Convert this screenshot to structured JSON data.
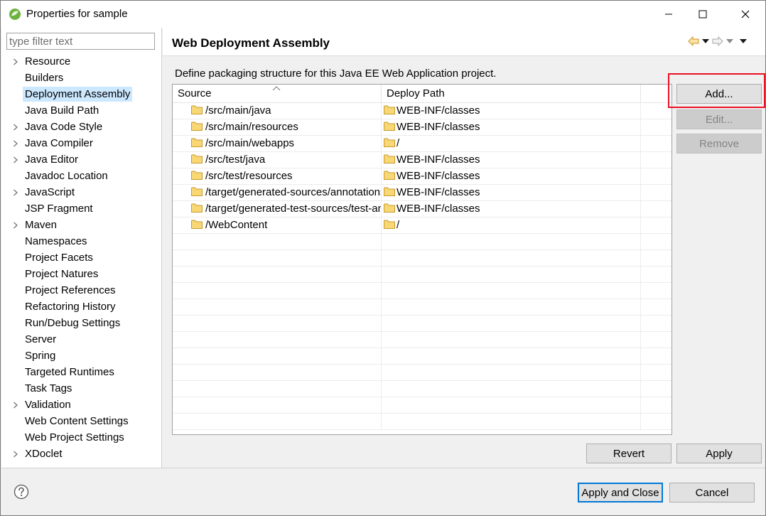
{
  "window": {
    "title": "Properties for sample"
  },
  "filter": {
    "placeholder": "type filter text"
  },
  "tree": {
    "items": [
      {
        "label": "Resource",
        "expandable": true,
        "selected": false
      },
      {
        "label": "Builders",
        "expandable": false,
        "selected": false
      },
      {
        "label": "Deployment Assembly",
        "expandable": false,
        "selected": true
      },
      {
        "label": "Java Build Path",
        "expandable": false,
        "selected": false
      },
      {
        "label": "Java Code Style",
        "expandable": true,
        "selected": false
      },
      {
        "label": "Java Compiler",
        "expandable": true,
        "selected": false
      },
      {
        "label": "Java Editor",
        "expandable": true,
        "selected": false
      },
      {
        "label": "Javadoc Location",
        "expandable": false,
        "selected": false
      },
      {
        "label": "JavaScript",
        "expandable": true,
        "selected": false
      },
      {
        "label": "JSP Fragment",
        "expandable": false,
        "selected": false
      },
      {
        "label": "Maven",
        "expandable": true,
        "selected": false
      },
      {
        "label": "Namespaces",
        "expandable": false,
        "selected": false
      },
      {
        "label": "Project Facets",
        "expandable": false,
        "selected": false
      },
      {
        "label": "Project Natures",
        "expandable": false,
        "selected": false
      },
      {
        "label": "Project References",
        "expandable": false,
        "selected": false
      },
      {
        "label": "Refactoring History",
        "expandable": false,
        "selected": false
      },
      {
        "label": "Run/Debug Settings",
        "expandable": false,
        "selected": false
      },
      {
        "label": "Server",
        "expandable": false,
        "selected": false
      },
      {
        "label": "Spring",
        "expandable": false,
        "selected": false
      },
      {
        "label": "Targeted Runtimes",
        "expandable": false,
        "selected": false
      },
      {
        "label": "Task Tags",
        "expandable": false,
        "selected": false
      },
      {
        "label": "Validation",
        "expandable": true,
        "selected": false
      },
      {
        "label": "Web Content Settings",
        "expandable": false,
        "selected": false
      },
      {
        "label": "Web Project Settings",
        "expandable": false,
        "selected": false
      },
      {
        "label": "XDoclet",
        "expandable": true,
        "selected": false
      }
    ]
  },
  "page": {
    "title": "Web Deployment Assembly",
    "description": "Define packaging structure for this Java EE Web Application project."
  },
  "table": {
    "columns": {
      "source": "Source",
      "deploy_path": "Deploy Path"
    },
    "rows": [
      {
        "source": "/src/main/java",
        "deploy_path": "WEB-INF/classes"
      },
      {
        "source": "/src/main/resources",
        "deploy_path": "WEB-INF/classes"
      },
      {
        "source": "/src/main/webapps",
        "deploy_path": "/"
      },
      {
        "source": "/src/test/java",
        "deploy_path": "WEB-INF/classes"
      },
      {
        "source": "/src/test/resources",
        "deploy_path": "WEB-INF/classes"
      },
      {
        "source": "/target/generated-sources/annotations",
        "deploy_path": "WEB-INF/classes"
      },
      {
        "source": "/target/generated-test-sources/test-annotations",
        "deploy_path": "WEB-INF/classes"
      },
      {
        "source": "/WebContent",
        "deploy_path": "/"
      }
    ],
    "empty_rows": 12
  },
  "buttons": {
    "add": "Add...",
    "edit": "Edit...",
    "remove": "Remove",
    "revert": "Revert",
    "apply": "Apply",
    "apply_and_close": "Apply and Close",
    "cancel": "Cancel"
  },
  "colors": {
    "selection": "#cce8ff",
    "highlight_box": "#e81123",
    "default_button_border": "#0078d7",
    "folder": "#f8d775"
  },
  "icons": {
    "app": "eclipse-spring-icon",
    "back": "back-arrow-icon",
    "forward": "forward-arrow-icon",
    "folder": "folder-icon",
    "help": "help-icon"
  }
}
